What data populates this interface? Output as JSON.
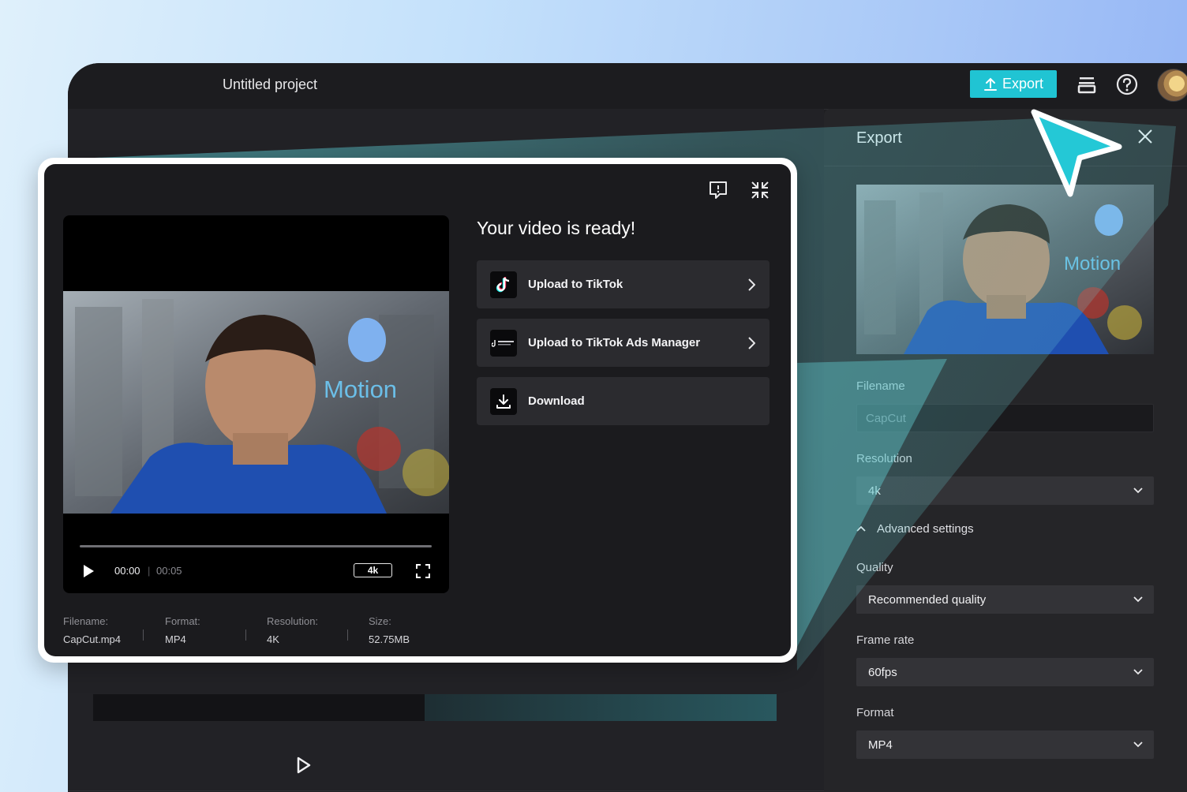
{
  "app": {
    "project_title": "Untitled project",
    "export_label": "Export"
  },
  "panel": {
    "title": "Export",
    "filename_label": "Filename",
    "filename_value": "CapCut",
    "resolution_label": "Resolution",
    "resolution_value": "4k",
    "advanced_label": "Advanced settings",
    "quality_label": "Quality",
    "quality_value": "Recommended quality",
    "framerate_label": "Frame rate",
    "framerate_value": "60fps",
    "format_label": "Format",
    "format_value": "MP4",
    "thumb_overlay_text": "Motion"
  },
  "modal": {
    "ready_title": "Your video is ready!",
    "actions": [
      {
        "label": "Upload to TikTok",
        "icon": "tiktok-icon"
      },
      {
        "label": "Upload to TikTok Ads Manager",
        "icon": "tiktok-business-icon"
      },
      {
        "label": "Download",
        "icon": "download-icon"
      }
    ],
    "player": {
      "current_time": "00:00",
      "duration": "00:05",
      "resolution_badge": "4k",
      "overlay_text": "Motion"
    },
    "meta": {
      "filename_key": "Filename:",
      "filename_val": "CapCut.mp4",
      "format_key": "Format:",
      "format_val": "MP4",
      "resolution_key": "Resolution:",
      "resolution_val": "4K",
      "size_key": "Size:",
      "size_val": "52.75MB"
    }
  },
  "colors": {
    "accent": "#20c4d3",
    "panel_bg": "#252528",
    "modal_bg": "#1b1b1e"
  }
}
